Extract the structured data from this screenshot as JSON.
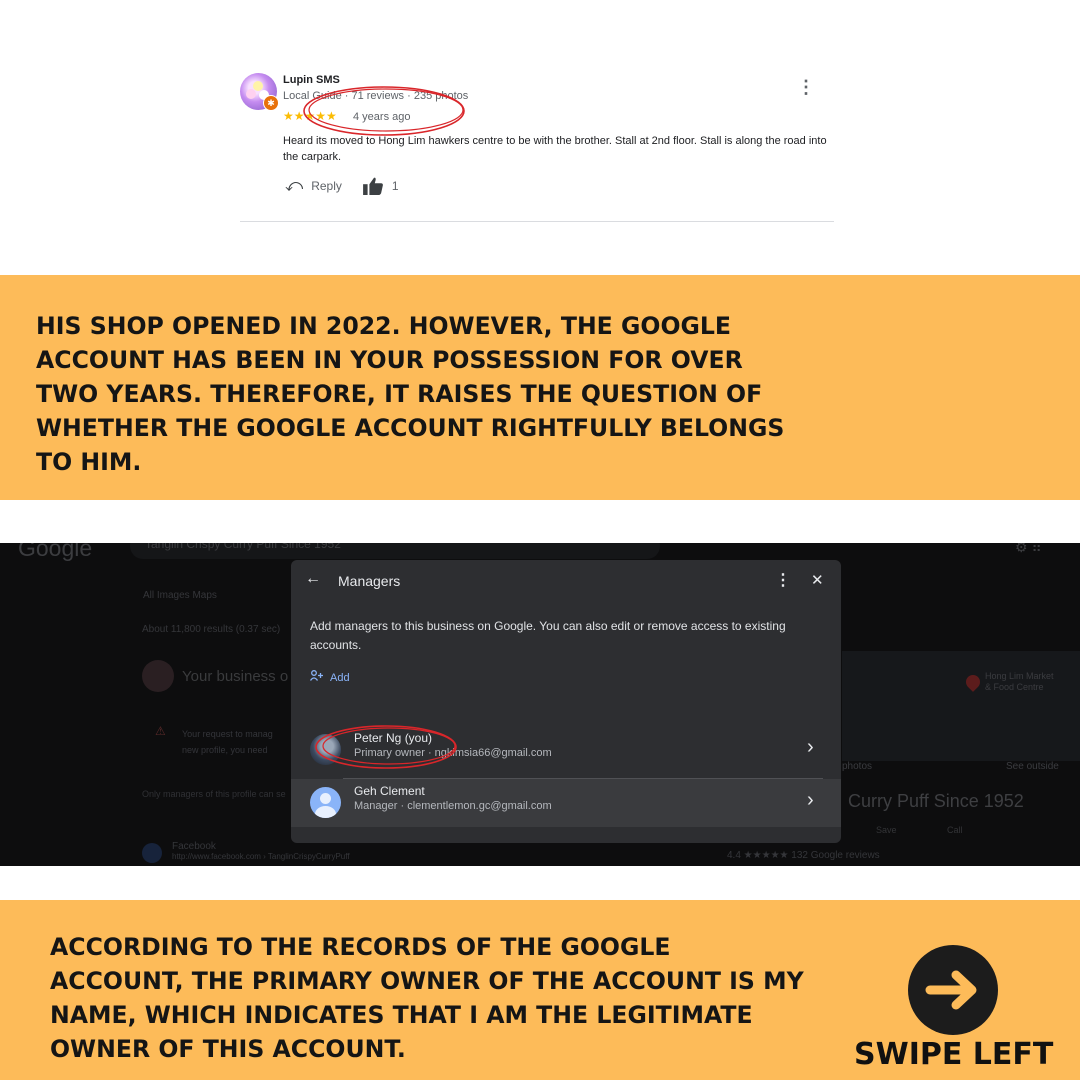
{
  "review": {
    "name": "Lupin SMS",
    "meta": "Local Guide · 71 reviews · 235 photos",
    "stars": "★★★★★",
    "rating": 5,
    "date": "4 years ago",
    "text": "Heard its moved to Hong Lim hawkers centre to be with the brother. Stall at 2nd floor. Stall is along the road into the carpark.",
    "reply_label": "Reply",
    "like_count": "1",
    "icons": [
      "more-vert-icon",
      "reply-icon",
      "thumbs-up-icon",
      "local-guide-badge-icon"
    ]
  },
  "band1": {
    "text": "His shop opened in 2022. However, the Google account has been in your possession for over two years. Therefore, it raises the question of whether the Google account rightfully belongs to him."
  },
  "screenshot": {
    "logo": "Google",
    "search_query": "Tanglin Crispy Curry Puff Since 1952",
    "tabs": "All   Images   Maps",
    "results_count": "About 11,800 results (0.37 sec)",
    "business_heading": "Your business o",
    "warning_text": "Your request to manag\nnew profile, you need",
    "only_managers": "Only managers of this profile can se",
    "fb_title": "Facebook",
    "fb_url": "http://www.facebook.com › TanglinCrispyCurryPuff",
    "map_label": "Hong Lim Market\n& Food Centre",
    "photos": "photos",
    "see_outside": "See outside",
    "right_title": "Curry Puff Since 1952",
    "right_buttons": "Save Call",
    "rating_line": "4.4 ★★★★★ 132 Google reviews"
  },
  "dialog": {
    "title": "Managers",
    "description": "Add managers to this business on Google. You can also edit or remove access to existing accounts.",
    "add_label": "Add",
    "managers": [
      {
        "name": "Peter Ng (you)",
        "role": "Primary owner · ngkimsia66@gmail.com"
      },
      {
        "name": "Geh Clement",
        "role": "Manager · clementlemon.gc@gmail.com"
      }
    ]
  },
  "band2": {
    "text": "According to the records of the Google account, the primary owner of the account is my name, which indicates that I am the legitimate owner of this account.",
    "swipe_label": "SWIPE LEFT"
  },
  "colors": {
    "band": "#fdbb59",
    "dialog_bg": "#2d2e31",
    "link_blue": "#8ab4f8",
    "annotation_red": "#d9262a",
    "star_yellow": "#fbbc04"
  }
}
